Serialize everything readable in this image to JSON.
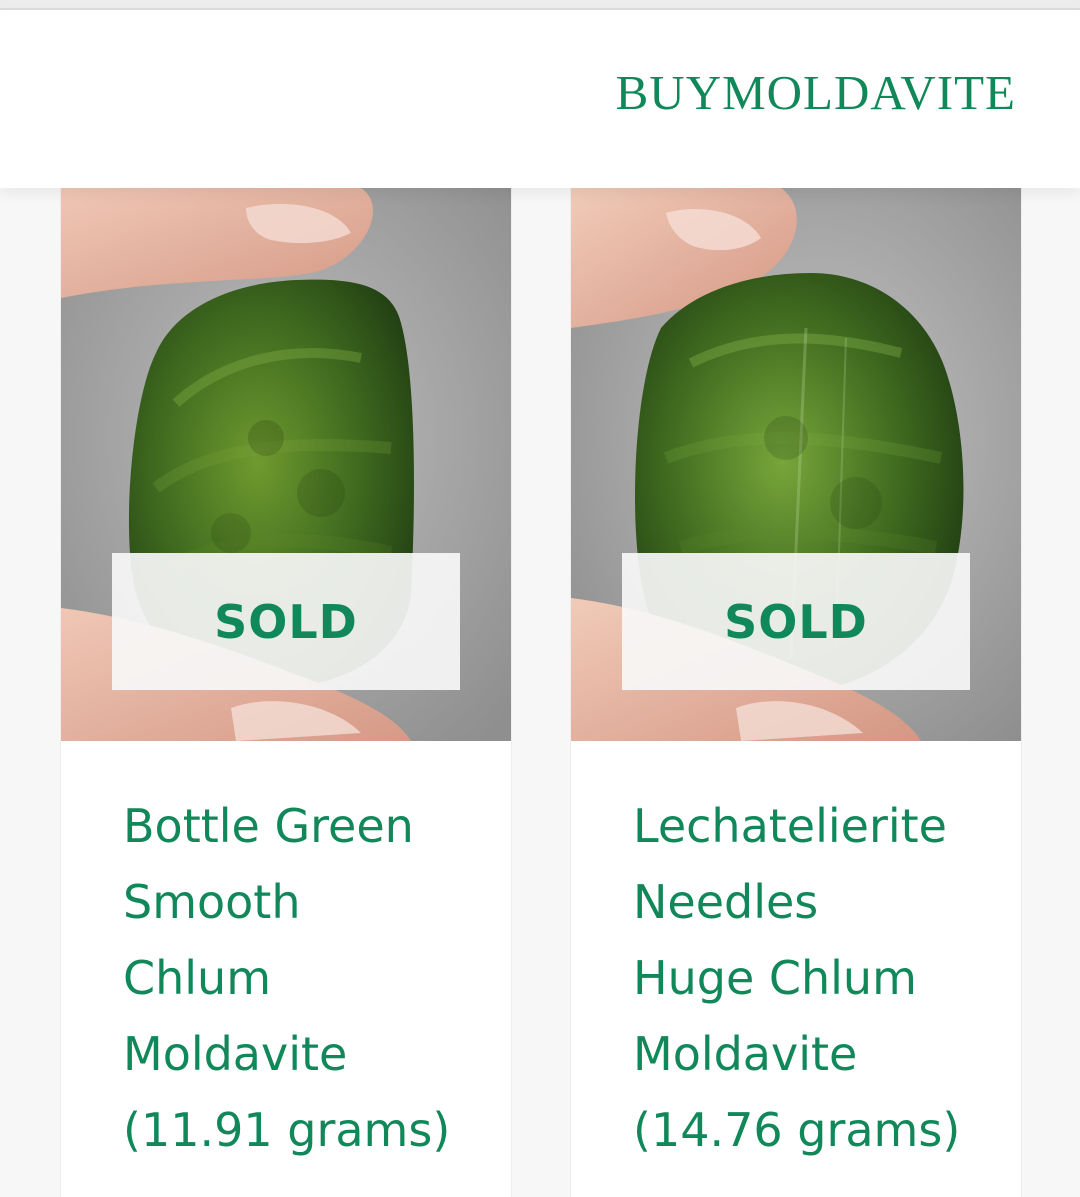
{
  "header": {
    "brand": "BUYMOLDAVITE"
  },
  "colors": {
    "accent": "#11885a",
    "background": "#f7f7f7"
  },
  "products": [
    {
      "status": "SOLD",
      "title": "Bottle Green\nSmooth\nChlum\nMoldavite\n(11.91 grams)",
      "image": "moldavite-stone-held-in-fingers"
    },
    {
      "status": "SOLD",
      "title": "Lechatelierite\nNeedles\nHuge Chlum\nMoldavite\n(14.76 grams)",
      "image": "moldavite-stone-held-in-fingers"
    }
  ]
}
